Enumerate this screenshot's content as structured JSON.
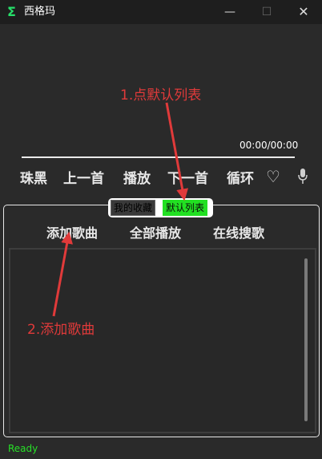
{
  "window": {
    "app_icon": "Σ",
    "title": "西格玛",
    "minimize_label": "—",
    "maximize_label": "☐",
    "close_label": "✕"
  },
  "player": {
    "time": "00:00/00:00",
    "progress": 0,
    "controls": [
      "珠黑",
      "上一首",
      "播放",
      "下一首",
      "循环"
    ],
    "icons": [
      "heart-icon",
      "microphone-icon"
    ]
  },
  "tabs": [
    {
      "label": "我的收藏",
      "active": false
    },
    {
      "label": "默认列表",
      "active": true,
      "color": "#22e022"
    }
  ],
  "actions": [
    "添加歌曲",
    "全部播放",
    "在线搜歌"
  ],
  "status": "Ready",
  "annotations": {
    "step1": "1.点默认列表",
    "step2": "2.添加歌曲",
    "color": "#e03a3a"
  },
  "colors": {
    "accent": "#27e027",
    "background": "#2a2a2a",
    "titlebar": "#1e1e1e"
  }
}
